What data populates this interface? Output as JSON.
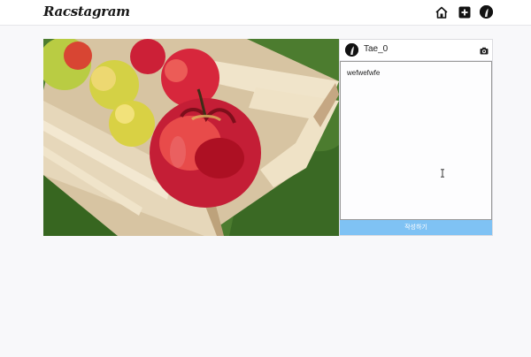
{
  "header": {
    "logo_text": "Racstagram",
    "icons": [
      "home-icon",
      "add-post-icon",
      "profile-avatar"
    ]
  },
  "post": {
    "image_description_icon": "apple-photo",
    "username": "Tae_0",
    "caption_value": "wefwefwfe",
    "submit_label": "작성하기",
    "camera_icon": "camera-icon"
  },
  "colors": {
    "submit_button": "#7fc2f4",
    "background": "#f8f8fa"
  }
}
